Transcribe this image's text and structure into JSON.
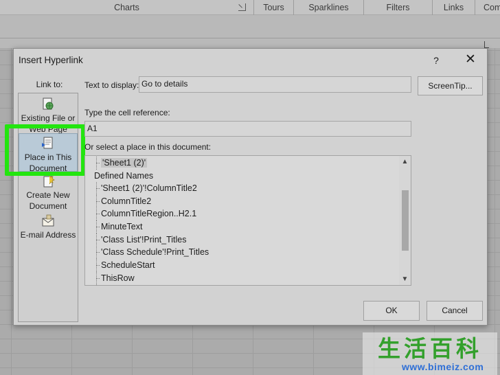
{
  "ribbon": {
    "groups": [
      "Charts",
      "Tours",
      "Sparklines",
      "Filters",
      "Links",
      "Com"
    ]
  },
  "dialog": {
    "title": "Insert Hyperlink",
    "help": "?",
    "close": "✕",
    "link_to_label": "Link to:",
    "link_options": [
      {
        "line1": "Existing File or",
        "line2": "Web Page",
        "icon": "globe-file-icon"
      },
      {
        "line1": "Place in This",
        "line2": "Document",
        "icon": "place-in-document-icon"
      },
      {
        "line1": "Create New",
        "line2": "Document",
        "icon": "new-document-icon"
      },
      {
        "line1": "E-mail Address",
        "line2": "",
        "icon": "email-icon"
      }
    ],
    "text_to_display_label": "Text to display:",
    "text_to_display_value": "Go to details",
    "screentip_button": "ScreenTip...",
    "cell_reference_label": "Type the cell reference:",
    "cell_reference_value": "A1",
    "select_place_label": "Or select a place in this document:",
    "tree": {
      "top_item": "'Sheet1 (2)'",
      "group": "Defined Names",
      "names": [
        "'Sheet1 (2)'!ColumnTitle2",
        "ColumnTitle2",
        "ColumnTitleRegion..H2.1",
        "MinuteText",
        "'Class List'!Print_Titles",
        "'Class Schedule'!Print_Titles",
        "ScheduleStart",
        "ThisRow"
      ]
    },
    "ok_button": "OK",
    "cancel_button": "Cancel"
  },
  "watermark": {
    "chinese": "生活百科",
    "url": "www.bimeiz.com"
  },
  "colors": {
    "highlight": "#23e50f",
    "selected_item": "#b9cad7",
    "watermark_green": "#33a02c",
    "watermark_blue": "#2f6fd6"
  }
}
